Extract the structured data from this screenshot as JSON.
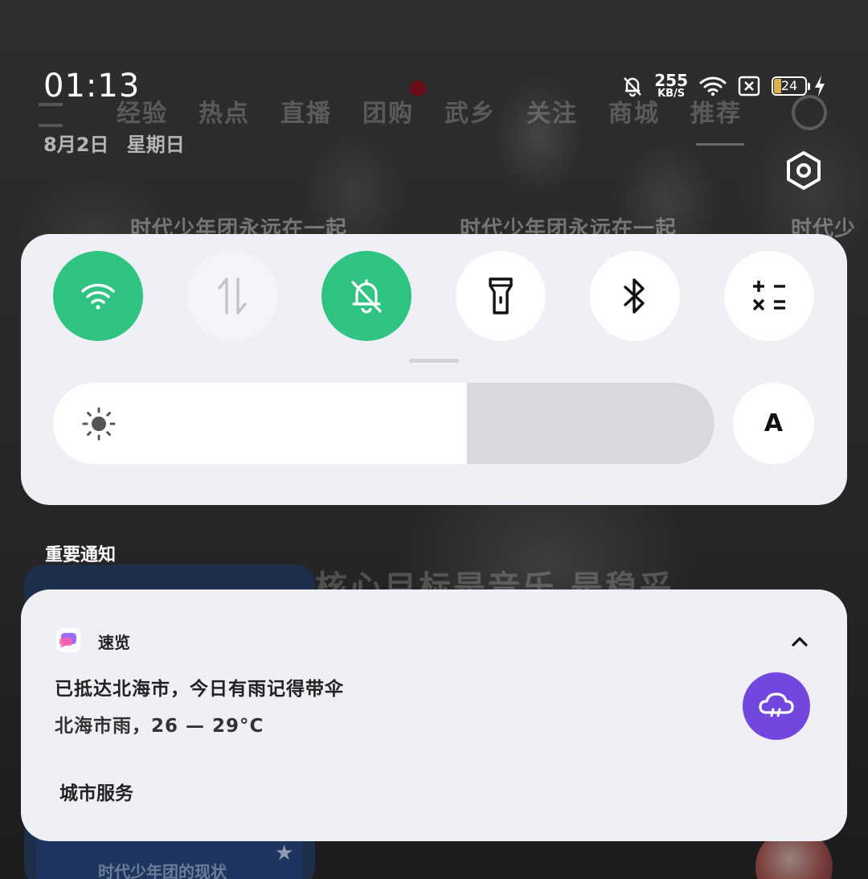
{
  "status_bar": {
    "time": "01:13",
    "date": "8月2日 星期日",
    "net_speed_value": "255",
    "net_speed_unit": "KB/S",
    "battery_level": "24",
    "icons": [
      "bell-muted-icon",
      "wifi-icon",
      "sim-missing-icon",
      "battery-icon",
      "charging-icon"
    ]
  },
  "background_app": {
    "tabs": [
      "经验",
      "热点",
      "直播",
      "团购",
      "武乡",
      "关注",
      "商城",
      "推荐"
    ],
    "captions": [
      "时代少年团永远在一起",
      "时代少年团永远在一起",
      "时代少"
    ],
    "overlay_text": "核心目标是音乐 是稳妥",
    "card_title": "时代少年团的现状"
  },
  "quick_settings": {
    "tiles": [
      {
        "name": "wifi",
        "state": "on",
        "icon": "wifi-icon"
      },
      {
        "name": "mobile-data",
        "state": "disabled",
        "icon": "data-arrows-icon"
      },
      {
        "name": "silent",
        "state": "on",
        "icon": "bell-muted-icon"
      },
      {
        "name": "flashlight",
        "state": "off",
        "icon": "flashlight-icon"
      },
      {
        "name": "bluetooth",
        "state": "off",
        "icon": "bluetooth-icon"
      },
      {
        "name": "calculator",
        "state": "off",
        "icon": "calculator-icon"
      }
    ],
    "brightness": 0.626,
    "auto_brightness_label": "A"
  },
  "notifications": {
    "section_title": "重要通知",
    "items": [
      {
        "app_name": "速览",
        "title": "已抵达北海市，今日有雨记得带伞",
        "body": "北海市雨，26 — 29°C",
        "action": "城市服务",
        "icon": "rain-cloud-icon"
      }
    ]
  },
  "colors": {
    "accent_green": "#2fc482",
    "weather_purple": "#7247e0",
    "panel_bg": "#eff0f5"
  }
}
